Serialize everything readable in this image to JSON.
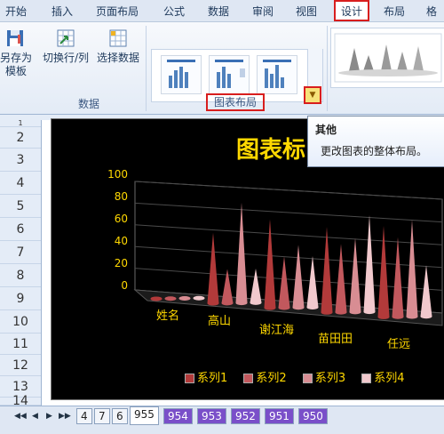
{
  "ribbon": {
    "tabs": [
      "开始",
      "插入",
      "页面布局",
      "公式",
      "数据",
      "审阅",
      "视图",
      "设计",
      "布局",
      "格"
    ],
    "active_tab": "设计",
    "buttons": {
      "save_template_line1": "另存为",
      "save_template_line2": "模板",
      "switch_row_col": "切换行/列",
      "select_data": "选择数据"
    },
    "group_data": "数据",
    "group_layout": "图表布局",
    "more_glyph": "▼"
  },
  "tooltip": {
    "title": "其他",
    "description": "更改图表的整体布局。"
  },
  "rows": [
    "1",
    "2",
    "3",
    "4",
    "5",
    "6",
    "7",
    "8",
    "9",
    "10",
    "11",
    "12",
    "13",
    "14"
  ],
  "chart_data": {
    "type": "bar",
    "title": "图表标",
    "categories": [
      "姓名",
      "高山",
      "谢江海",
      "苗田田",
      "任远"
    ],
    "ylim": [
      0,
      100
    ],
    "yticks": [
      "100",
      "80",
      "60",
      "40",
      "20",
      "0"
    ],
    "series": [
      {
        "name": "系列1",
        "values": [
          0,
          62,
          78,
          75,
          80
        ]
      },
      {
        "name": "系列2",
        "values": [
          0,
          30,
          45,
          60,
          70
        ]
      },
      {
        "name": "系列3",
        "values": [
          0,
          88,
          55,
          65,
          85
        ]
      },
      {
        "name": "系列4",
        "values": [
          0,
          30,
          45,
          85,
          45
        ]
      }
    ],
    "legend": "bottom",
    "colors": [
      "#b23a3a",
      "#c2585d",
      "#d88d93",
      "#f1c9cd"
    ]
  },
  "sheet_tabs": {
    "tabs": [
      "4",
      "7",
      "6",
      "955",
      "954",
      "953",
      "952",
      "951",
      "950"
    ],
    "active": "955"
  }
}
